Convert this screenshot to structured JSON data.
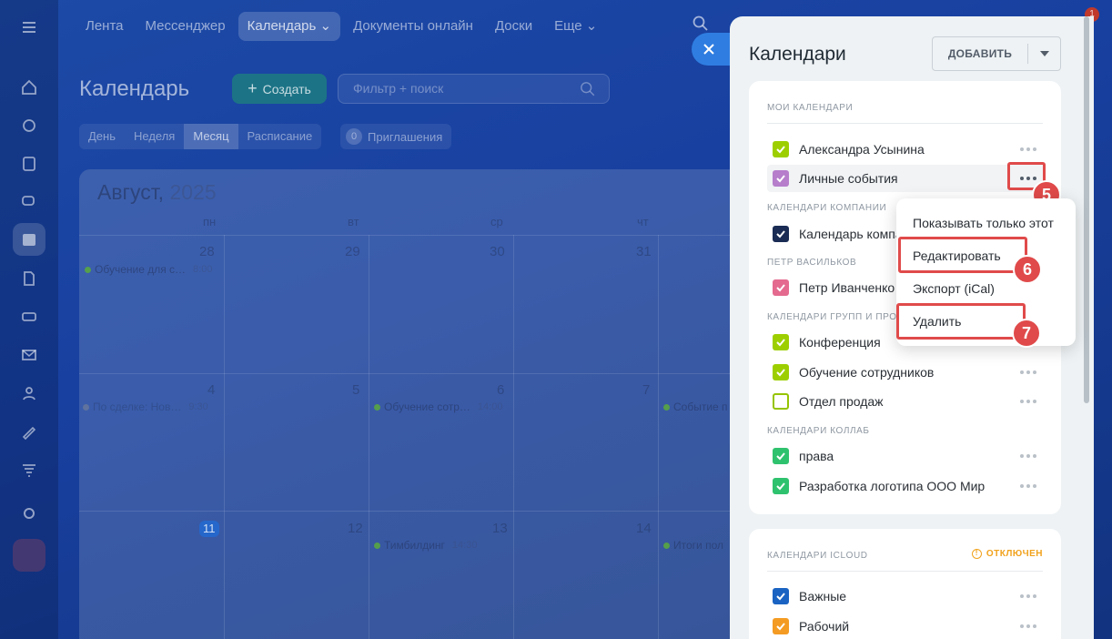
{
  "topnav": {
    "items": [
      "Лента",
      "Мессенджер",
      "Календарь",
      "Документы онлайн",
      "Доски",
      "Еще"
    ],
    "notification_count": "1"
  },
  "calendar_page": {
    "title": "Календарь",
    "create_label": "Создать",
    "filter_placeholder": "Фильтр + поиск",
    "view_tabs": [
      "День",
      "Неделя",
      "Месяц",
      "Расписание"
    ],
    "invites_count": "0",
    "invites_label": "Приглашения",
    "month": "Август,",
    "year": "2025",
    "weekdays": [
      "пн",
      "вт",
      "ср",
      "чт"
    ],
    "week1_days": [
      "28",
      "29",
      "30",
      "31"
    ],
    "week2_days": [
      "4",
      "5",
      "6",
      "7"
    ],
    "week3_days": [
      "11",
      "12",
      "13",
      "14"
    ],
    "events": {
      "e1": {
        "title": "Обучение для с…",
        "time": "8:00"
      },
      "e2": {
        "title": "По сделке: Нов…",
        "time": "9:30"
      },
      "e3": {
        "title": "Обучение сотр…",
        "time": "14:00"
      },
      "e4": {
        "title": "Событие п"
      },
      "e5": {
        "title": "Тимбилдинг",
        "time": "14:30"
      },
      "e6": {
        "title": "Итоги пол"
      }
    }
  },
  "panel": {
    "title": "Календари",
    "add_label": "ДОБАВИТЬ",
    "sections": {
      "my": "МОИ КАЛЕНДАРИ",
      "company": "КАЛЕНДАРИ КОМПАНИИ",
      "petr": "ПЕТР ВАСИЛЬКОВ",
      "groups": "КАЛЕНДАРИ ГРУПП И ПРОЕКТОВ",
      "collab": "КАЛЕНДАРИ КОЛЛАБ",
      "icloud": "КАЛЕНДАРИ ICLOUD"
    },
    "icloud_status": "ОТКЛЮЧЕН",
    "calendars": {
      "c1": {
        "label": "Александра Усынина",
        "color": "#9dcf00"
      },
      "c2": {
        "label": "Личные события",
        "color": "#b67ecb"
      },
      "c3": {
        "label": "Календарь компании",
        "color": "#1a2c54"
      },
      "c4": {
        "label": "Петр Иванченко",
        "color": "#e46a8f"
      },
      "c5": {
        "label": "Конференция",
        "color": "#9dcf00"
      },
      "c6": {
        "label": "Обучение сотрудников",
        "color": "#9dcf00"
      },
      "c7": {
        "label": "Отдел продаж",
        "color": "#ffffff"
      },
      "c8": {
        "label": "права",
        "color": "#2fc26e"
      },
      "c9": {
        "label": "Разработка логотипа ООО Мир",
        "color": "#2fc26e"
      },
      "c10": {
        "label": "Важные",
        "color": "#1a63c2"
      },
      "c11": {
        "label": "Рабочий",
        "color": "#f49b23"
      }
    }
  },
  "context_menu": {
    "show_only": "Показывать только этот",
    "edit": "Редактировать",
    "export": "Экспорт (iCal)",
    "delete": "Удалить"
  },
  "steps": [
    "5",
    "6",
    "7"
  ],
  "colors": {
    "accent": "#2f7de1",
    "highlight": "#e04a4a"
  }
}
